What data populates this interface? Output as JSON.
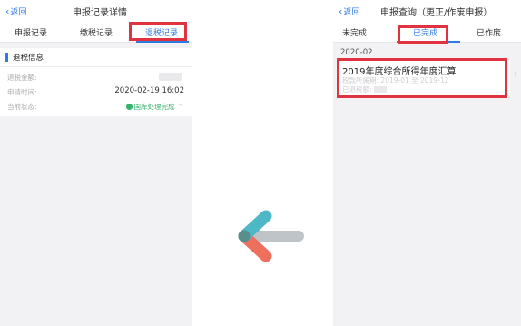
{
  "left_screen": {
    "back_label": "返回",
    "title": "申报记录详情",
    "tabs": [
      {
        "label": "申报记录"
      },
      {
        "label": "缴税记录"
      },
      {
        "label": "退税记录"
      }
    ],
    "section_title": "退税信息",
    "rows": [
      {
        "label": "退税金额:",
        "value": ""
      },
      {
        "label": "申请时间:",
        "value": "2020-02-19 16:02"
      },
      {
        "label": "当前状态:",
        "value": "国库处理完成"
      }
    ]
  },
  "right_screen": {
    "back_label": "返回",
    "title": "申报查询（更正/作废申报）",
    "tabs": [
      {
        "label": "未完成"
      },
      {
        "label": "已完成"
      },
      {
        "label": "已作废"
      }
    ],
    "month_group": "2020-02",
    "card": {
      "title": "2019年度综合所得年度汇算",
      "period_label": "税款所属期:",
      "period_value": "2019-01 至 2019-12",
      "refund_label": "已退税额:"
    }
  },
  "colors": {
    "accent": "#2f7ae5",
    "highlight": "#e0333f",
    "status_green": "#33b46b",
    "arrow_teal": "#4fb8c6",
    "arrow_red": "#ee6f5e",
    "arrow_gray": "#bfc4c8"
  }
}
